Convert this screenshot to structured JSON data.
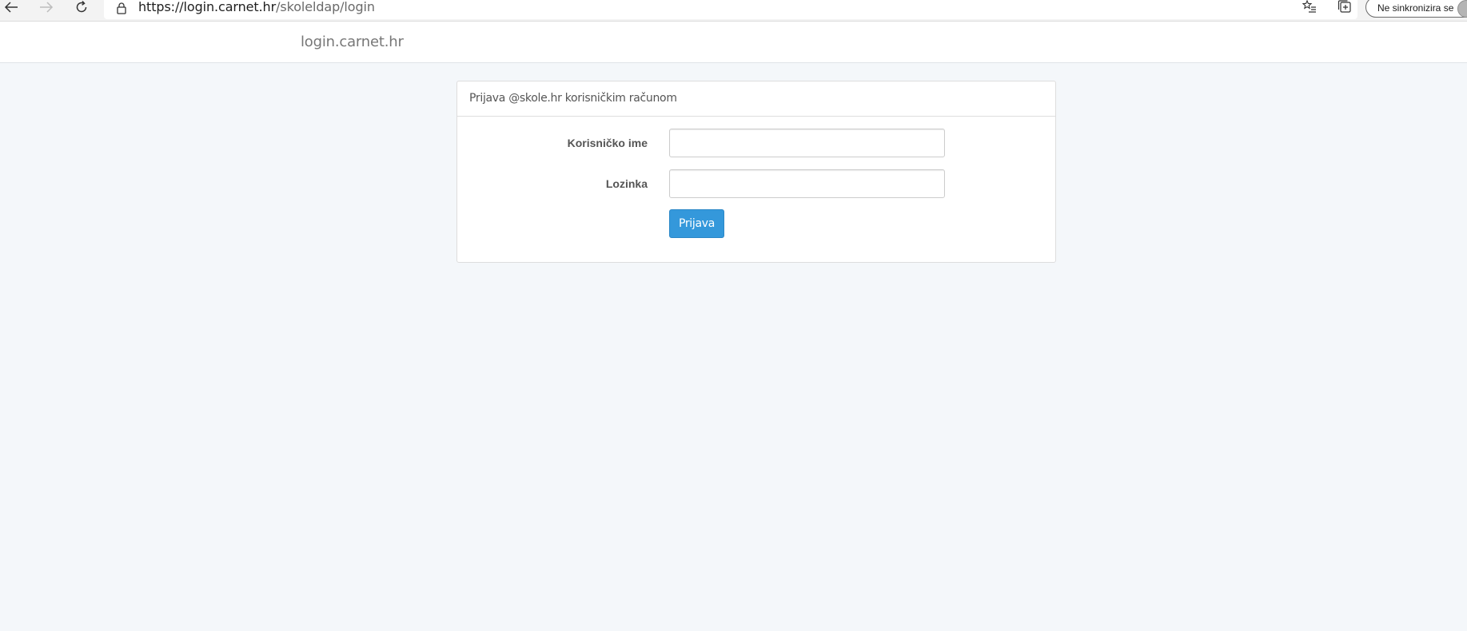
{
  "browser": {
    "url_host": "https://login.carnet.hr",
    "url_path": "/skoleldap/login",
    "sync_label": "Ne sinkronizira se",
    "icons": {
      "back": "arrow-left-icon",
      "forward": "arrow-right-icon",
      "refresh": "refresh-icon",
      "lock": "lock-icon",
      "favorite": "star-icon",
      "favorites_list": "favorites-list-icon",
      "collections": "collections-icon"
    }
  },
  "header": {
    "brand": "login.carnet.hr"
  },
  "panel": {
    "title": "Prijava @skole.hr korisničkim računom",
    "username_label": "Korisničko ime",
    "username_value": "",
    "password_label": "Lozinka",
    "password_value": "",
    "submit_label": "Prijava"
  },
  "colors": {
    "accent": "#3498db",
    "page_background": "#f4f7fa"
  }
}
